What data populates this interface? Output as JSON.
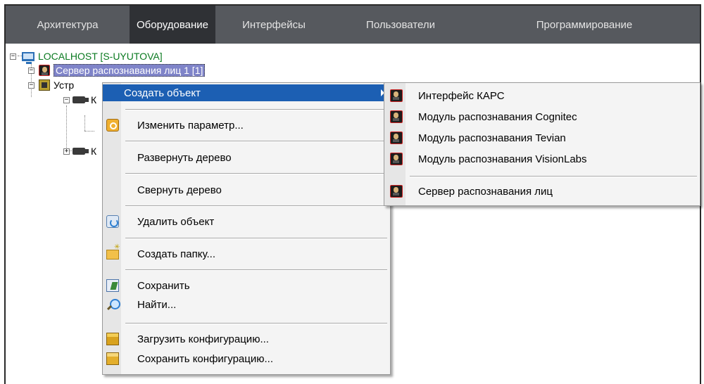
{
  "tabs": [
    {
      "label": "Архитектура",
      "active": false
    },
    {
      "label": "Оборудование",
      "active": true
    },
    {
      "label": "Интерфейсы",
      "active": false
    },
    {
      "label": "Пользователи",
      "active": false
    },
    {
      "label": "Программирование",
      "active": false
    }
  ],
  "tree": {
    "root": {
      "label": "LOCALHOST [S-UYUTOVA]",
      "icon": "monitor-icon"
    },
    "selected": {
      "label": "Сервер распознавания лиц 1 [1]",
      "icon": "face-server-icon"
    },
    "device": {
      "label": "Устр",
      "icon": "chip-icon"
    },
    "child1": {
      "label": "К",
      "icon": "camera-icon"
    },
    "child2": {
      "label": "К",
      "icon": "camera-icon"
    }
  },
  "context_menu": {
    "items": [
      {
        "label": "Создать объект",
        "icon": "",
        "submenu": true,
        "highlighted": true
      },
      {
        "label": "Изменить параметр...",
        "icon": "key-icon"
      },
      {
        "label": "Развернуть дерево",
        "icon": ""
      },
      {
        "label": "Свернуть дерево",
        "icon": ""
      },
      {
        "label": "Удалить объект",
        "icon": "recycle-bin-icon"
      },
      {
        "label": "Создать папку...",
        "icon": "new-folder-icon"
      },
      {
        "label": "Сохранить",
        "icon": "save-icon"
      },
      {
        "label": "Найти...",
        "icon": "magnifier-icon"
      },
      {
        "label": "Загрузить конфигурацию...",
        "icon": "load-config-icon"
      },
      {
        "label": "Сохранить конфигурацию...",
        "icon": "save-config-icon"
      }
    ]
  },
  "submenu": {
    "items": [
      {
        "label": "Интерфейс КАРС",
        "icon": "face-module-icon"
      },
      {
        "label": "Модуль распознавания Cognitec",
        "icon": "face-module-icon"
      },
      {
        "label": "Модуль распознавания Tevian",
        "icon": "face-module-icon"
      },
      {
        "label": "Модуль распознавания VisionLabs",
        "icon": "face-module-icon"
      },
      {
        "label": "Сервер распознавания лиц",
        "icon": "face-module-icon"
      }
    ]
  },
  "colors": {
    "tabbar_bg": "#56595e",
    "tab_active_bg": "#2f3135",
    "menu_highlight": "#1c5fb3",
    "tree_selection": "#7f84c9",
    "root_label": "#0a7a20"
  }
}
